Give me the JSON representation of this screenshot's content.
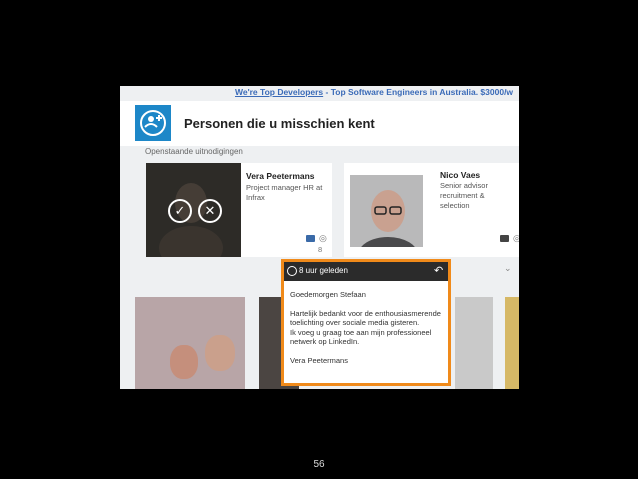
{
  "ad": {
    "link": "We're Top Developers",
    "rest": " - Top Software Engineers in Australia. $3000/w"
  },
  "panel": {
    "title": "Personen die u misschien kent",
    "icon": "add-contact-icon"
  },
  "pending_label": "Openstaande uitnodigingen",
  "cards": [
    {
      "name": "Vera Peetermans",
      "title": "Project manager HR at Infrax",
      "views": "8"
    },
    {
      "name": "Nico Vaes",
      "title": "Senior advisor recruitment & selection"
    }
  ],
  "popup": {
    "time": "8 uur geleden",
    "lines": [
      "Goedemorgen Stefaan",
      "Hartelijk bedankt voor de enthousiasmerende toelichting over sociale media gisteren.",
      "Ik voeg u graag toe aan mijn professioneel netwerk op LinkedIn.",
      "Vera Peetermans"
    ]
  },
  "page_number": "56",
  "colors": {
    "accent": "#1d87c8",
    "highlight": "#f08a1a",
    "link": "#3b6bb8"
  }
}
